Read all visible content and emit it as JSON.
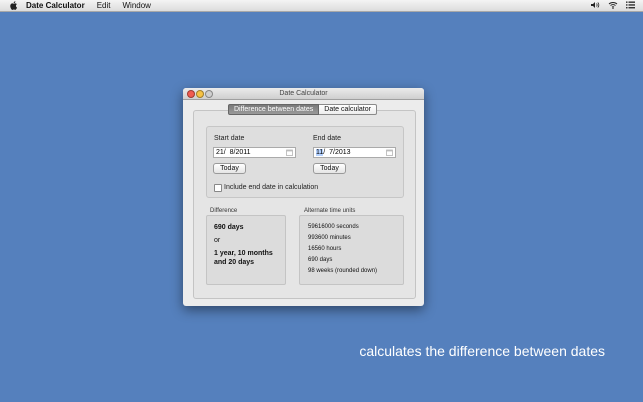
{
  "menubar": {
    "app_name": "Date Calculator",
    "items": [
      "Edit",
      "Window"
    ]
  },
  "window": {
    "title": "Date Calculator",
    "tabs": [
      "Difference between dates",
      "Date calculator"
    ],
    "start_date": {
      "label": "Start date",
      "day": "21",
      "rest": "/  8/2011",
      "today_button": "Today"
    },
    "end_date": {
      "label": "End date",
      "day": "11",
      "rest": "/  7/2013",
      "today_button": "Today"
    },
    "include_end_label": "Include end date in calculation",
    "difference": {
      "label": "Difference",
      "days": "690 days",
      "or": "or",
      "ymd_line1": "1 year, 10 months",
      "ymd_line2": "and 20 days"
    },
    "alternate": {
      "label": "Alternate time units",
      "lines": [
        "59616000 seconds",
        "993600 minutes",
        "16560 hours",
        "690 days",
        "98 weeks (rounded down)"
      ]
    }
  },
  "caption": "calculates the difference between dates"
}
